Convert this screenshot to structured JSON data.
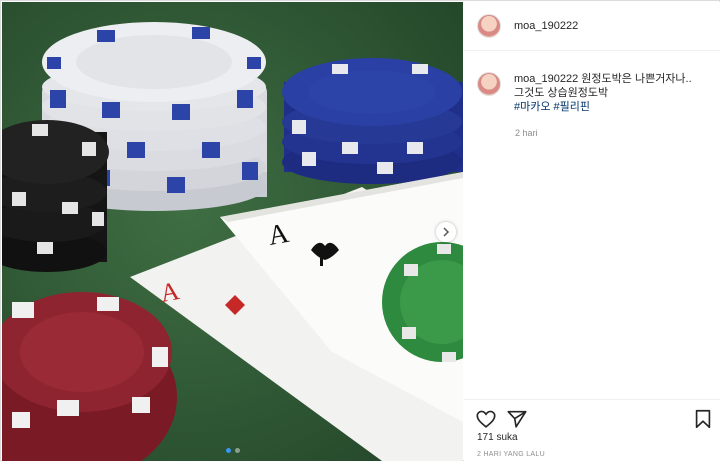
{
  "post": {
    "username": "moa_190222",
    "caption_line1": "원정도박은 나쁜거자나..",
    "caption_line2": "그것도 상습원정도박",
    "hashtags": [
      "#마카오",
      "#필리핀"
    ],
    "comment_age": "2 hari",
    "likes": "171 suka",
    "posted_ago": "2 HARI YANG LALU"
  },
  "carousel": {
    "total_slides": 2,
    "active_slide": 1
  },
  "icons": {
    "like": "heart-icon",
    "share": "paper-plane-icon",
    "save": "bookmark-icon",
    "next": "chevron-right-icon"
  },
  "colors": {
    "hashtag": "#003569",
    "active_dot": "#3897f0",
    "table_felt": "#2f5a34"
  }
}
